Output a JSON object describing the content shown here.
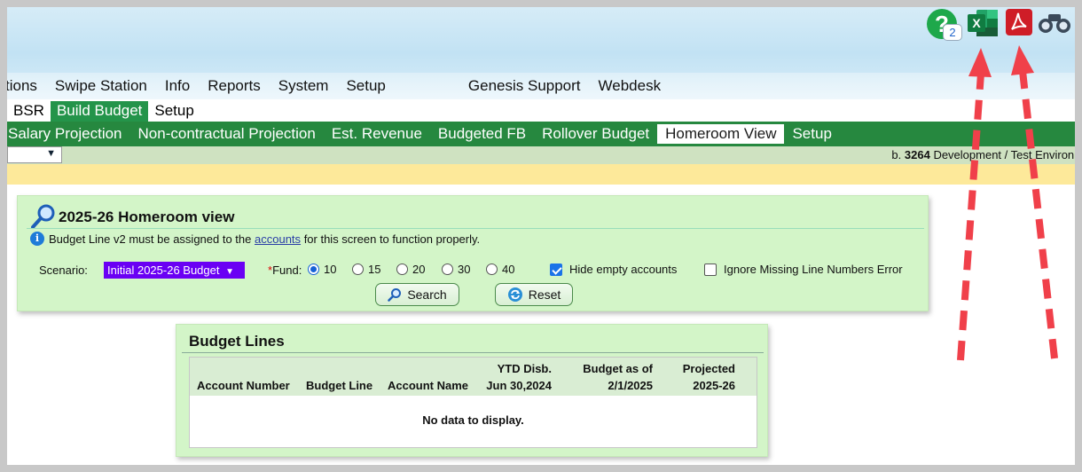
{
  "menu": {
    "items": [
      "tions",
      "Swipe Station",
      "Info",
      "Reports",
      "System",
      "Setup",
      "Genesis Support",
      "Webdesk"
    ]
  },
  "subnav": {
    "items": [
      "BSR",
      "Build Budget",
      "Setup"
    ],
    "active": "Build Budget"
  },
  "greennav": {
    "items": [
      "Salary Projection",
      "Non-contractual Projection",
      "Est. Revenue",
      "Budgeted FB",
      "Rollover Budget",
      "Homeroom View",
      "Setup"
    ],
    "active": "Homeroom View"
  },
  "env": {
    "prefix": "b.",
    "code": "3264",
    "text": "Development / Test Environm"
  },
  "toolbar": {
    "help_badge": "2",
    "help_glyph": "?",
    "excel_glyph": "X"
  },
  "homeroom": {
    "title": "2025-26 Homeroom view",
    "info_prefix": "Budget Line v2 must be assigned to the",
    "info_link": "accounts",
    "info_suffix": "for this screen to function properly.",
    "scenario_label": "Scenario:",
    "scenario_value": "Initial 2025-26 Budget",
    "fund_star": "*",
    "fund_label": "Fund:",
    "fund_options": [
      "10",
      "15",
      "20",
      "30",
      "40"
    ],
    "fund_selected": "10",
    "hide_empty_label": "Hide empty accounts",
    "hide_empty_checked": true,
    "ignore_missing_label": "Ignore Missing Line Numbers Error",
    "ignore_missing_checked": false,
    "search_label": "Search",
    "reset_label": "Reset"
  },
  "budget_lines": {
    "title": "Budget Lines",
    "columns": {
      "account_number": "Account Number",
      "budget_line": "Budget Line",
      "account_name": "Account Name",
      "ytd_line1": "YTD Disb.",
      "ytd_line2": "Jun 30,2024",
      "budget_line1": "Budget as of",
      "budget_line2": "2/1/2025",
      "projected_line1": "Projected",
      "projected_line2": "2025-26"
    },
    "empty_text": "No data to display."
  },
  "colors": {
    "nav_green": "#26883f",
    "panel_green": "#d3f5c8",
    "scenario_purple": "#6a00f4",
    "arrow_red": "#f0404a"
  }
}
